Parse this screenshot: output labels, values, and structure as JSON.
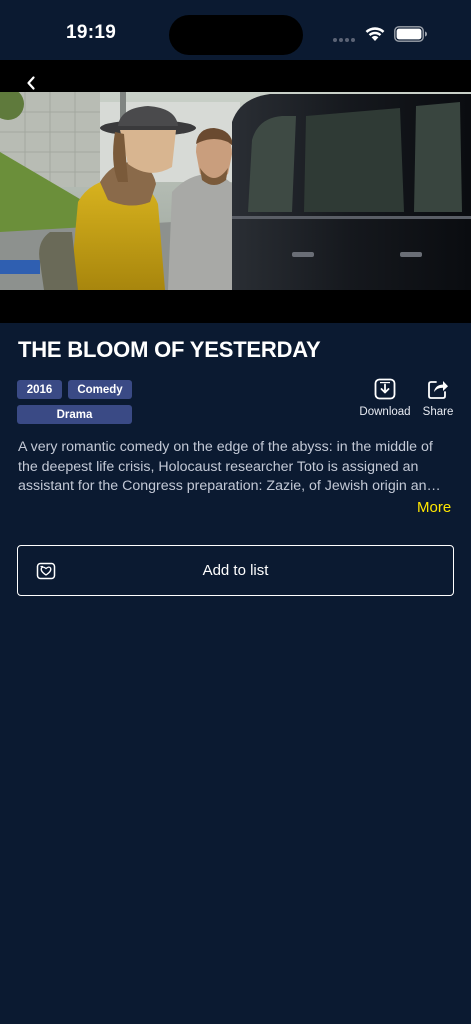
{
  "status_bar": {
    "time": "19:19"
  },
  "movie": {
    "title": "THE BLOOM OF YESTERDAY",
    "tags": [
      "2016",
      "Comedy",
      "Drama"
    ],
    "description": "A very romantic comedy on the edge of the abyss: in the middle of the deepest life crisis, Holocaust researcher Toto is assigned an assistant for the Congress preparation: Zazie, of Jewish origin an…",
    "more_label": "More"
  },
  "actions": {
    "download_label": "Download",
    "share_label": "Share",
    "add_to_list_label": "Add to list"
  },
  "colors": {
    "background": "#0b1a31",
    "tag_background": "#3a4a85",
    "accent_more": "#ffe600"
  },
  "icons": [
    "back-chevron-icon",
    "wifi-icon",
    "battery-icon",
    "download-icon",
    "share-icon",
    "add-to-list-icon"
  ]
}
